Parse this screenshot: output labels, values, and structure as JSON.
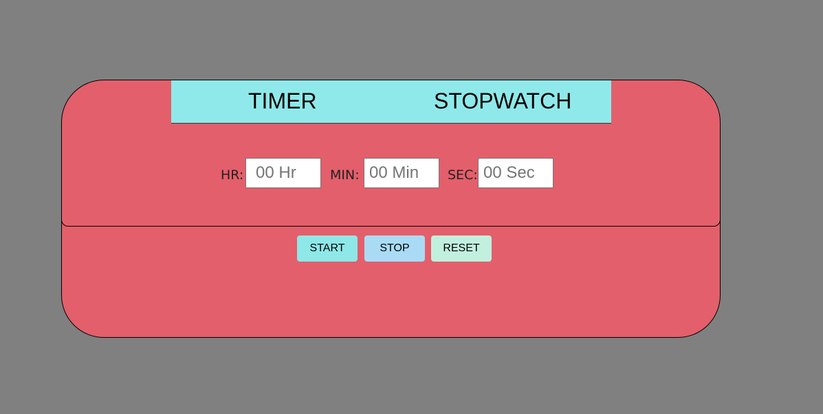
{
  "tabs": {
    "timer": "TIMER",
    "stopwatch": "STOPWATCH"
  },
  "fields": {
    "hr": {
      "label": "HR:",
      "placeholder": "00 Hr"
    },
    "min": {
      "label": "MIN:",
      "placeholder": "00 Min"
    },
    "sec": {
      "label": "SEC:",
      "placeholder": "00 Sec"
    }
  },
  "buttons": {
    "start": "START",
    "stop": "STOP",
    "reset": "RESET"
  },
  "colors": {
    "page_background": "#808080",
    "card_background": "#e35f6b",
    "tab_bar_background": "#8fe9ea",
    "start_button": "#8de8e7",
    "stop_button": "#a9dcf4",
    "reset_button": "#c1f0df"
  }
}
